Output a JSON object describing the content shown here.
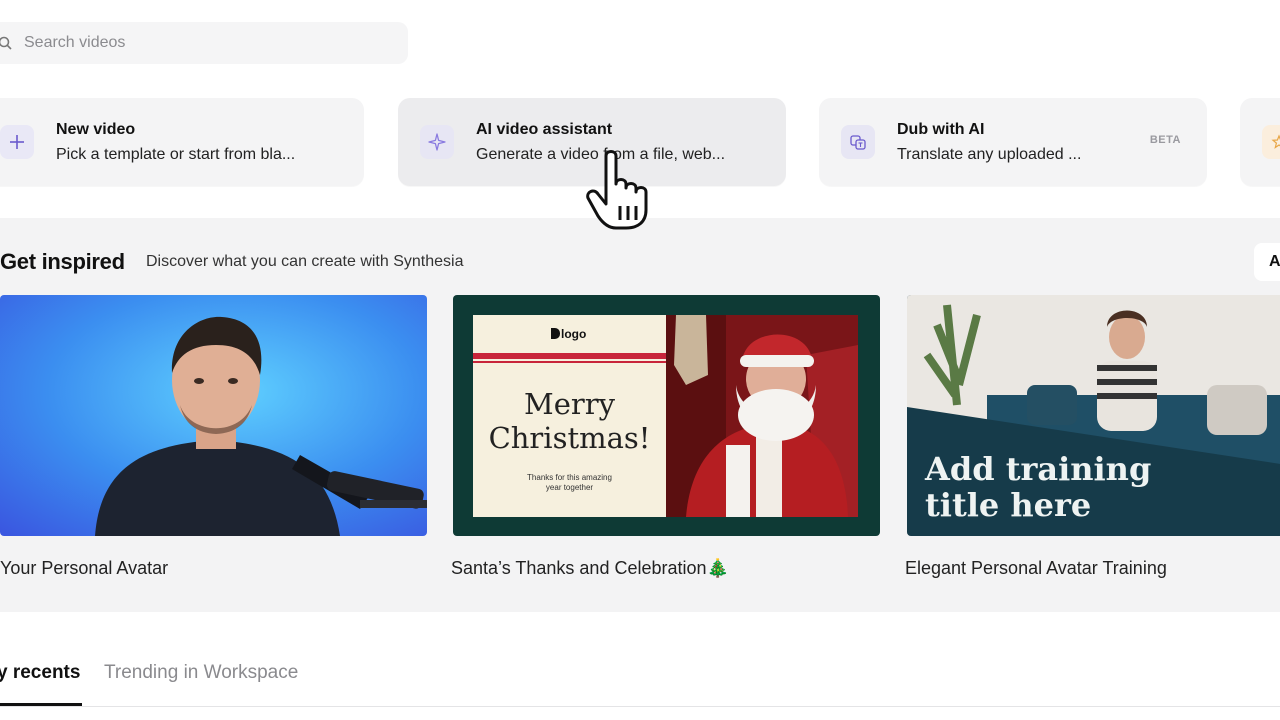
{
  "search": {
    "placeholder": "Search videos",
    "icon": "search-icon"
  },
  "quick_actions": [
    {
      "title": "New video",
      "subtitle": "Pick a template or start from bla...",
      "icon": "plus-icon"
    },
    {
      "title": "AI video assistant",
      "subtitle": "Generate a video from a file, web...",
      "icon": "sparkle-icon"
    },
    {
      "title": "Dub with AI",
      "subtitle": "Translate any uploaded ...",
      "icon": "translate-icon",
      "badge": "BETA"
    }
  ],
  "inspired": {
    "title": "Get inspired",
    "subtitle": "Discover what you can create with Synthesia",
    "all_button": "A",
    "items": [
      {
        "caption": "Your Personal Avatar"
      },
      {
        "caption": "Santa’s Thanks and Celebration🎄",
        "thumb_logo": "logo",
        "thumb_heading_1": "Merry",
        "thumb_heading_2": "Christmas!",
        "thumb_small_1": "Thanks for this amazing",
        "thumb_small_2": "year together"
      },
      {
        "caption": "Elegant Personal Avatar Training",
        "thumb_line_1": "Add training",
        "thumb_line_2": "title here"
      }
    ]
  },
  "tabs": [
    {
      "label": "y recents",
      "active": true
    },
    {
      "label": "Trending in Workspace",
      "active": false
    }
  ],
  "colors": {
    "accent_purple": "#6a5acd",
    "avatar_bg_blue": "#4a9af0",
    "training_teal": "#163b4a",
    "christmas_red": "#c8253a"
  }
}
